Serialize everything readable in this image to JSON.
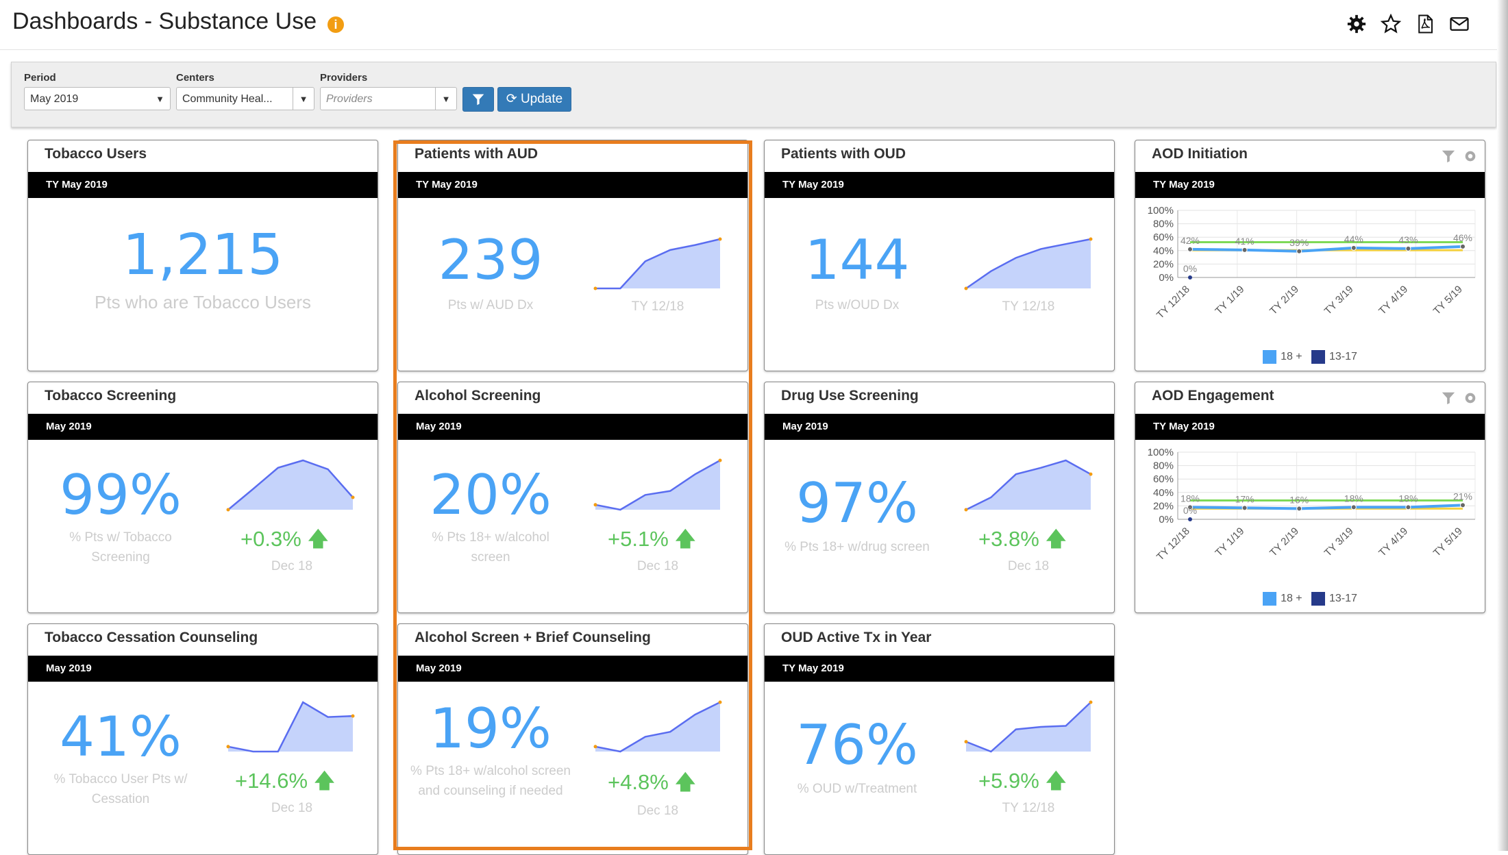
{
  "header": {
    "title": "Dashboards - Substance Use",
    "info_icon": "info-icon"
  },
  "filters": {
    "period": {
      "label": "Period",
      "value": "May 2019"
    },
    "centers": {
      "label": "Centers",
      "value": "Community Heal..."
    },
    "providers": {
      "label": "Providers",
      "placeholder": "Providers"
    },
    "update_label": "Update"
  },
  "cards": {
    "tobacco_users": {
      "title": "Tobacco Users",
      "period": "TY May 2019",
      "value": "1,215",
      "subtitle": "Pts who are Tobacco Users"
    },
    "patients_aud": {
      "title": "Patients with AUD",
      "period": "TY May 2019",
      "value": "239",
      "subtitle": "Pts w/ AUD Dx",
      "compare": "TY 12/18",
      "spark": [
        0.0,
        0.0,
        0.55,
        0.78,
        0.88,
        1.0
      ]
    },
    "patients_oud": {
      "title": "Patients with OUD",
      "period": "TY May 2019",
      "value": "144",
      "subtitle": "Pts w/OUD Dx",
      "compare": "TY 12/18",
      "spark": [
        0.0,
        0.35,
        0.62,
        0.8,
        0.9,
        1.0
      ]
    },
    "tobacco_screening": {
      "title": "Tobacco Screening",
      "period": "May 2019",
      "value": "99%",
      "subtitle": "% Pts w/ Tobacco Screening",
      "delta": "+0.3%",
      "compare": "Dec 18",
      "spark": [
        0.0,
        0.42,
        0.85,
        1.0,
        0.82,
        0.25
      ]
    },
    "alcohol_screening": {
      "title": "Alcohol Screening",
      "period": "May 2019",
      "value": "20%",
      "subtitle": "% Pts 18+ w/alcohol screen",
      "delta": "+5.1%",
      "compare": "Dec 18",
      "spark": [
        0.1,
        0.0,
        0.3,
        0.38,
        0.72,
        1.0
      ]
    },
    "drug_screening": {
      "title": "Drug Use Screening",
      "period": "May 2019",
      "value": "97%",
      "subtitle": "% Pts 18+ w/drug screen",
      "delta": "+3.8%",
      "compare": "Dec 18",
      "spark": [
        0.0,
        0.25,
        0.72,
        0.85,
        1.0,
        0.72
      ]
    },
    "tobacco_cessation": {
      "title": "Tobacco Cessation Counseling",
      "period": "May 2019",
      "value": "41%",
      "subtitle": "% Tobacco User Pts w/ Cessation",
      "delta": "+14.6%",
      "compare": "Dec 18",
      "spark": [
        0.1,
        0.0,
        0.0,
        1.0,
        0.7,
        0.72
      ]
    },
    "alcohol_brief": {
      "title": "Alcohol Screen + Brief Counseling",
      "period": "May 2019",
      "value": "19%",
      "subtitle": "% Pts 18+ w/alcohol screen and counseling if needed",
      "delta": "+4.8%",
      "compare": "Dec 18",
      "spark": [
        0.1,
        0.0,
        0.3,
        0.4,
        0.75,
        1.0
      ]
    },
    "oud_active": {
      "title": "OUD Active Tx in Year",
      "period": "TY May 2019",
      "value": "76%",
      "subtitle": "% OUD w/Treatment",
      "delta": "+5.9%",
      "compare": "TY 12/18",
      "spark": [
        0.2,
        0.0,
        0.45,
        0.5,
        0.52,
        1.0
      ]
    },
    "aod_initiation": {
      "title": "AOD Initiation",
      "period": "TY May 2019"
    },
    "aod_engagement": {
      "title": "AOD Engagement",
      "period": "TY May 2019"
    }
  },
  "chart_data": [
    {
      "type": "line",
      "title": "AOD Initiation",
      "categories": [
        "TY 12/18",
        "TY 1/19",
        "TY 2/19",
        "TY 3/19",
        "TY 4/19",
        "TY 5/19"
      ],
      "y_ticks": [
        "100%",
        "80%",
        "60%",
        "40%",
        "20%",
        "0%"
      ],
      "ylim": [
        0,
        100
      ],
      "series": [
        {
          "name": "18 +",
          "values": [
            42,
            41,
            39,
            44,
            43,
            46
          ],
          "color": "#4aa3f5"
        },
        {
          "name": "13-17",
          "values": [
            0,
            null,
            null,
            null,
            null,
            null
          ],
          "color": "#263a8a"
        }
      ],
      "data_labels": [
        "42%",
        "41%",
        "39%",
        "44%",
        "43%",
        "46%",
        "0%"
      ],
      "legend": "bottom"
    },
    {
      "type": "line",
      "title": "AOD Engagement",
      "categories": [
        "TY 12/18",
        "TY 1/19",
        "TY 2/19",
        "TY 3/19",
        "TY 4/19",
        "TY 5/19"
      ],
      "y_ticks": [
        "100%",
        "80%",
        "60%",
        "40%",
        "20%",
        "0%"
      ],
      "ylim": [
        0,
        100
      ],
      "series": [
        {
          "name": "18 +",
          "values": [
            18,
            17,
            16,
            18,
            18,
            21
          ],
          "color": "#4aa3f5"
        },
        {
          "name": "13-17",
          "values": [
            0,
            null,
            null,
            null,
            null,
            null
          ],
          "color": "#263a8a"
        }
      ],
      "data_labels": [
        "18%",
        "17%",
        "16%",
        "18%",
        "18%",
        "21%",
        "0%"
      ],
      "legend": "bottom"
    }
  ],
  "colors": {
    "accent": "#4aa3f5",
    "delta": "#5cc45c",
    "highlight": "#e87d1e",
    "button": "#337ab7"
  }
}
